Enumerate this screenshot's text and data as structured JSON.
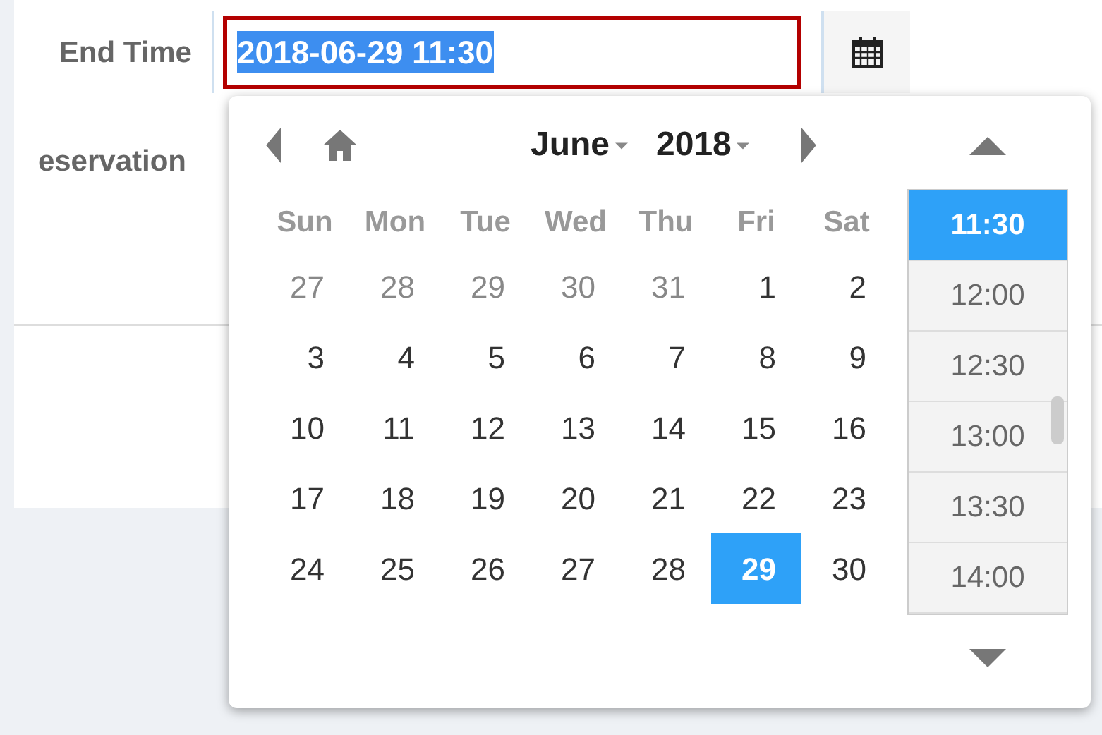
{
  "form": {
    "end_time": {
      "label": "End Time",
      "value": "2018-06-29 11:30"
    },
    "reservation": {
      "label": "eservation"
    }
  },
  "picker": {
    "month": "June",
    "year": "2018",
    "weekdays": [
      "Sun",
      "Mon",
      "Tue",
      "Wed",
      "Thu",
      "Fri",
      "Sat"
    ],
    "weeks": [
      [
        {
          "day": "27",
          "other_month": true,
          "selected": false
        },
        {
          "day": "28",
          "other_month": true,
          "selected": false
        },
        {
          "day": "29",
          "other_month": true,
          "selected": false
        },
        {
          "day": "30",
          "other_month": true,
          "selected": false
        },
        {
          "day": "31",
          "other_month": true,
          "selected": false
        },
        {
          "day": "1",
          "other_month": false,
          "selected": false
        },
        {
          "day": "2",
          "other_month": false,
          "selected": false
        }
      ],
      [
        {
          "day": "3",
          "other_month": false,
          "selected": false
        },
        {
          "day": "4",
          "other_month": false,
          "selected": false
        },
        {
          "day": "5",
          "other_month": false,
          "selected": false
        },
        {
          "day": "6",
          "other_month": false,
          "selected": false
        },
        {
          "day": "7",
          "other_month": false,
          "selected": false
        },
        {
          "day": "8",
          "other_month": false,
          "selected": false
        },
        {
          "day": "9",
          "other_month": false,
          "selected": false
        }
      ],
      [
        {
          "day": "10",
          "other_month": false,
          "selected": false
        },
        {
          "day": "11",
          "other_month": false,
          "selected": false
        },
        {
          "day": "12",
          "other_month": false,
          "selected": false
        },
        {
          "day": "13",
          "other_month": false,
          "selected": false
        },
        {
          "day": "14",
          "other_month": false,
          "selected": false
        },
        {
          "day": "15",
          "other_month": false,
          "selected": false
        },
        {
          "day": "16",
          "other_month": false,
          "selected": false
        }
      ],
      [
        {
          "day": "17",
          "other_month": false,
          "selected": false
        },
        {
          "day": "18",
          "other_month": false,
          "selected": false
        },
        {
          "day": "19",
          "other_month": false,
          "selected": false
        },
        {
          "day": "20",
          "other_month": false,
          "selected": false
        },
        {
          "day": "21",
          "other_month": false,
          "selected": false
        },
        {
          "day": "22",
          "other_month": false,
          "selected": false
        },
        {
          "day": "23",
          "other_month": false,
          "selected": false
        }
      ],
      [
        {
          "day": "24",
          "other_month": false,
          "selected": false
        },
        {
          "day": "25",
          "other_month": false,
          "selected": false
        },
        {
          "day": "26",
          "other_month": false,
          "selected": false
        },
        {
          "day": "27",
          "other_month": false,
          "selected": false
        },
        {
          "day": "28",
          "other_month": false,
          "selected": false
        },
        {
          "day": "29",
          "other_month": false,
          "selected": true
        },
        {
          "day": "30",
          "other_month": false,
          "selected": false
        }
      ]
    ],
    "times": [
      {
        "label": "11:30",
        "selected": true
      },
      {
        "label": "12:00",
        "selected": false
      },
      {
        "label": "12:30",
        "selected": false
      },
      {
        "label": "13:00",
        "selected": false
      },
      {
        "label": "13:30",
        "selected": false
      },
      {
        "label": "14:00",
        "selected": false
      }
    ]
  }
}
